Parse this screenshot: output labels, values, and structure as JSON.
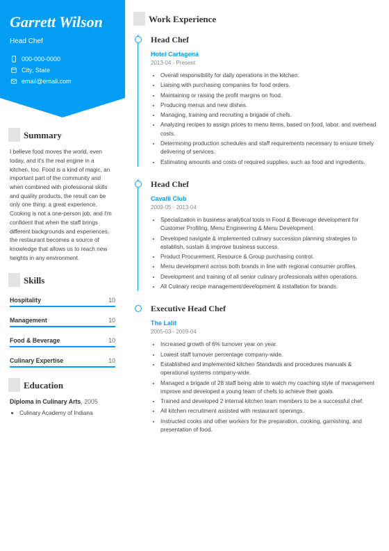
{
  "name": "Garrett Wilson",
  "role": "Head Chef",
  "contacts": {
    "phone": "000-000-0000",
    "location": "City, State",
    "email": "email@email.com"
  },
  "sections": {
    "summary": "Summary",
    "skills": "Skills",
    "education": "Education",
    "work": "Work Experience"
  },
  "summary": "I believe food moves the world, even today, and it's the real engine in a kitchen, too. Food is a kind of magic, an important part of the community and when combined with professional skills and quality products, the result can be only one thing: a great experience. Cooking is not a one-person job, and I'm confident that when the staff brings different backgrounds and experiences, the restaurant becomes a source of knowledge that allows us to reach new heights in any environment.",
  "skills": [
    {
      "name": "Hospitality",
      "value": "10"
    },
    {
      "name": "Management",
      "value": "10"
    },
    {
      "name": "Food & Beverage",
      "value": "10"
    },
    {
      "name": "Culinary Expertise",
      "value": "10"
    }
  ],
  "education": {
    "degree": "Diploma in Culinary Arts",
    "year": "2005",
    "school": "Culinary Academy of Indiana"
  },
  "jobs": [
    {
      "title": "Head Chef",
      "company": "Hotel Cartagena",
      "dates": "2013-04 - Present",
      "bullets": [
        "Overall responsibility for daily operations in the kitchen.",
        "Liaising with purchasing companies for food orders.",
        "Maintaining or raising the profit margins on food.",
        "Producing menus and new dishes.",
        "Managing, training and recruiting a brigade of chefs.",
        "Analyzing recipes to assign prices to menu items, based on food, labor, and overhead costs.",
        "Determining production schedules and staff requirements necessary to ensure timely delivering of services.",
        "Estimating amounts and costs of required supplies, such as food and ingredients."
      ]
    },
    {
      "title": "Head Chef",
      "company": "Cavalli Club",
      "dates": "2009-05 - 2013-04",
      "bullets": [
        "Specialization in business analytical tools in Food & Beverage development for Customer Profiling, Menu Engineering & Menu Development.",
        "Developed navigate & implemented culinary succession planning strategies to establish, sustain & improve business success.",
        "Product Procurement, Resource & Group purchasing control.",
        "Menu development across both brands in line with regional consumer profiles.",
        "Development and training of all senior culinary professionals within operations.",
        "All Culinary recipe management/development & installation for brands."
      ]
    },
    {
      "title": "Executive Head Chef",
      "company": "The Lalit",
      "dates": "2005-03 - 2009-04",
      "bullets": [
        "Increased growth of 6% turnover year on year.",
        "Lowest staff turnover percentage company-wide.",
        "Established and implemented kitchen Standards and procedures manuals & operational systems company-wide.",
        "Managed a brigade of 28 staff being able to watch my coaching style of management improve and developed a young team of chefs to achieve their goals.",
        "Trained and developed 2 internal kitchen team members to be a successful chef.",
        "All kitchen recruitment assisted with restaurant openings.",
        "Instructed cooks and other workers for the preparation, cooking, garnishing, and presentation of food."
      ]
    }
  ]
}
